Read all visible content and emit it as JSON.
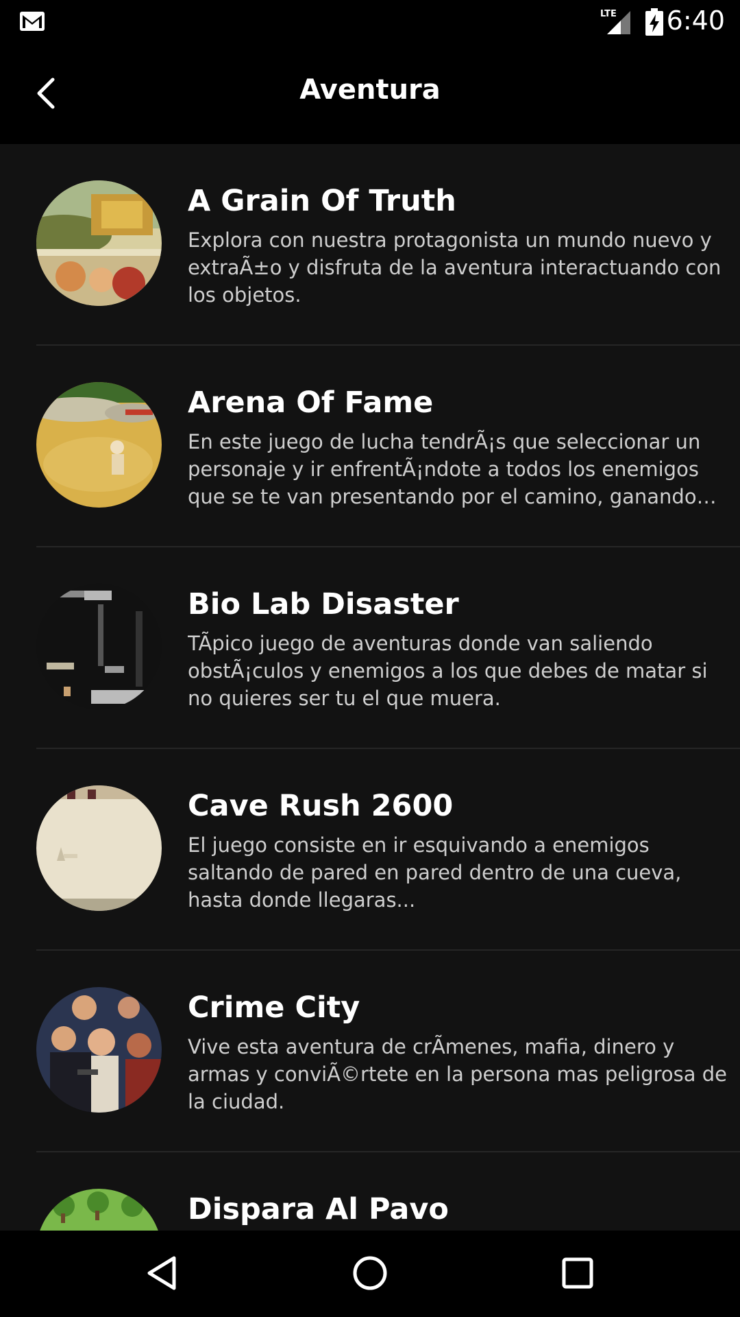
{
  "status_bar": {
    "time": "6:40",
    "network": "LTE",
    "icons": [
      "mail-icon",
      "lte-signal-icon",
      "battery-charging-icon"
    ]
  },
  "app_bar": {
    "title": "Aventura",
    "back_icon": "back-arrow-icon"
  },
  "games": [
    {
      "title": "A Grain Of Truth",
      "description": "Explora con nuestra protagonista un mundo nuevo y extraÃ±o y disfruta de la aventura interactuando con los objetos."
    },
    {
      "title": "Arena Of Fame",
      "description": "En este juego de lucha tendrÃ¡s que seleccionar un personaje y ir enfrentÃ¡ndote a todos los enemigos que se te van presentando por el camino, ganando puntos."
    },
    {
      "title": "Bio Lab Disaster",
      "description": "TÃpico juego de aventuras donde van saliendo obstÃ¡culos y enemigos a los que debes de matar si no quieres ser tu el que muera."
    },
    {
      "title": "Cave Rush 2600",
      "description": "El juego consiste en ir esquivando a enemigos saltando de pared en pared dentro de una cueva, hasta donde llegaras..."
    },
    {
      "title": "Crime City",
      "description": "Vive esta aventura de crÃmenes, mafia, dinero y armas y conviÃ©rtete en la persona mas peligrosa de la ciudad."
    },
    {
      "title": "Dispara Al Pavo",
      "description": ""
    }
  ],
  "nav_bar": {
    "icons": [
      "nav-back-icon",
      "nav-home-icon",
      "nav-recents-icon"
    ]
  }
}
